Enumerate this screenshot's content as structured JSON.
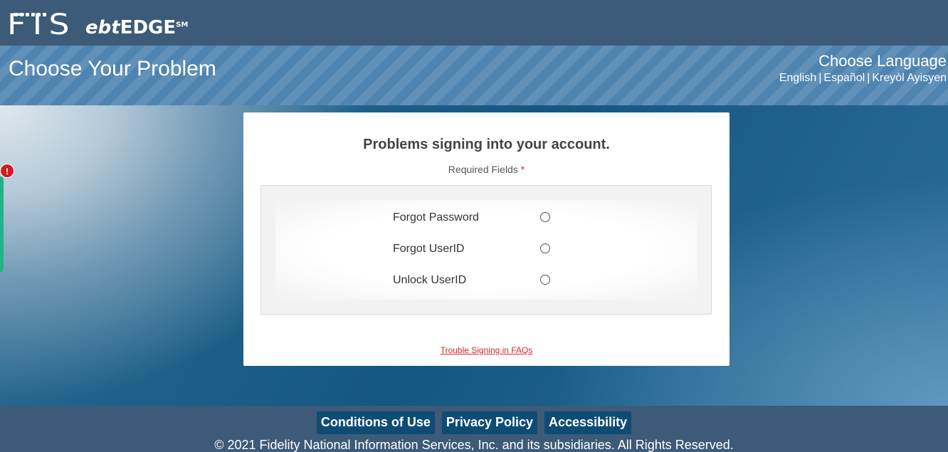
{
  "brand": {
    "fis_text": "FIS",
    "ebt_italic": "ebt",
    "edge": "EDGE",
    "sm": "SM"
  },
  "header": {
    "page_title": "Choose Your Problem",
    "language_title": "Choose Language",
    "languages": [
      "English",
      "Español",
      "Kreyòl Ayisyen"
    ],
    "separator": "|"
  },
  "side_alert": {
    "symbol": "!",
    "color": "#cc1f1f",
    "tab_color": "#1fb489"
  },
  "card": {
    "heading": "Problems signing into your account.",
    "required_label": "Required Fields",
    "required_marker": "*",
    "options": [
      {
        "label": "Forgot Password",
        "selected": false
      },
      {
        "label": "Forgot UserID",
        "selected": false
      },
      {
        "label": "Unlock UserID",
        "selected": false
      }
    ],
    "faq_link": "Trouble Signing in FAQs"
  },
  "footer": {
    "links": [
      "Conditions of Use",
      "Privacy Policy",
      "Accessibility"
    ],
    "copyright": "© 2021 Fidelity National Information Services, Inc. and its subsidiaries. All Rights Reserved."
  },
  "colors": {
    "topbar": "#3c5b78",
    "title_band": "#4f84b0",
    "footer_button": "#0f4c74",
    "link_red": "#d9262d"
  }
}
